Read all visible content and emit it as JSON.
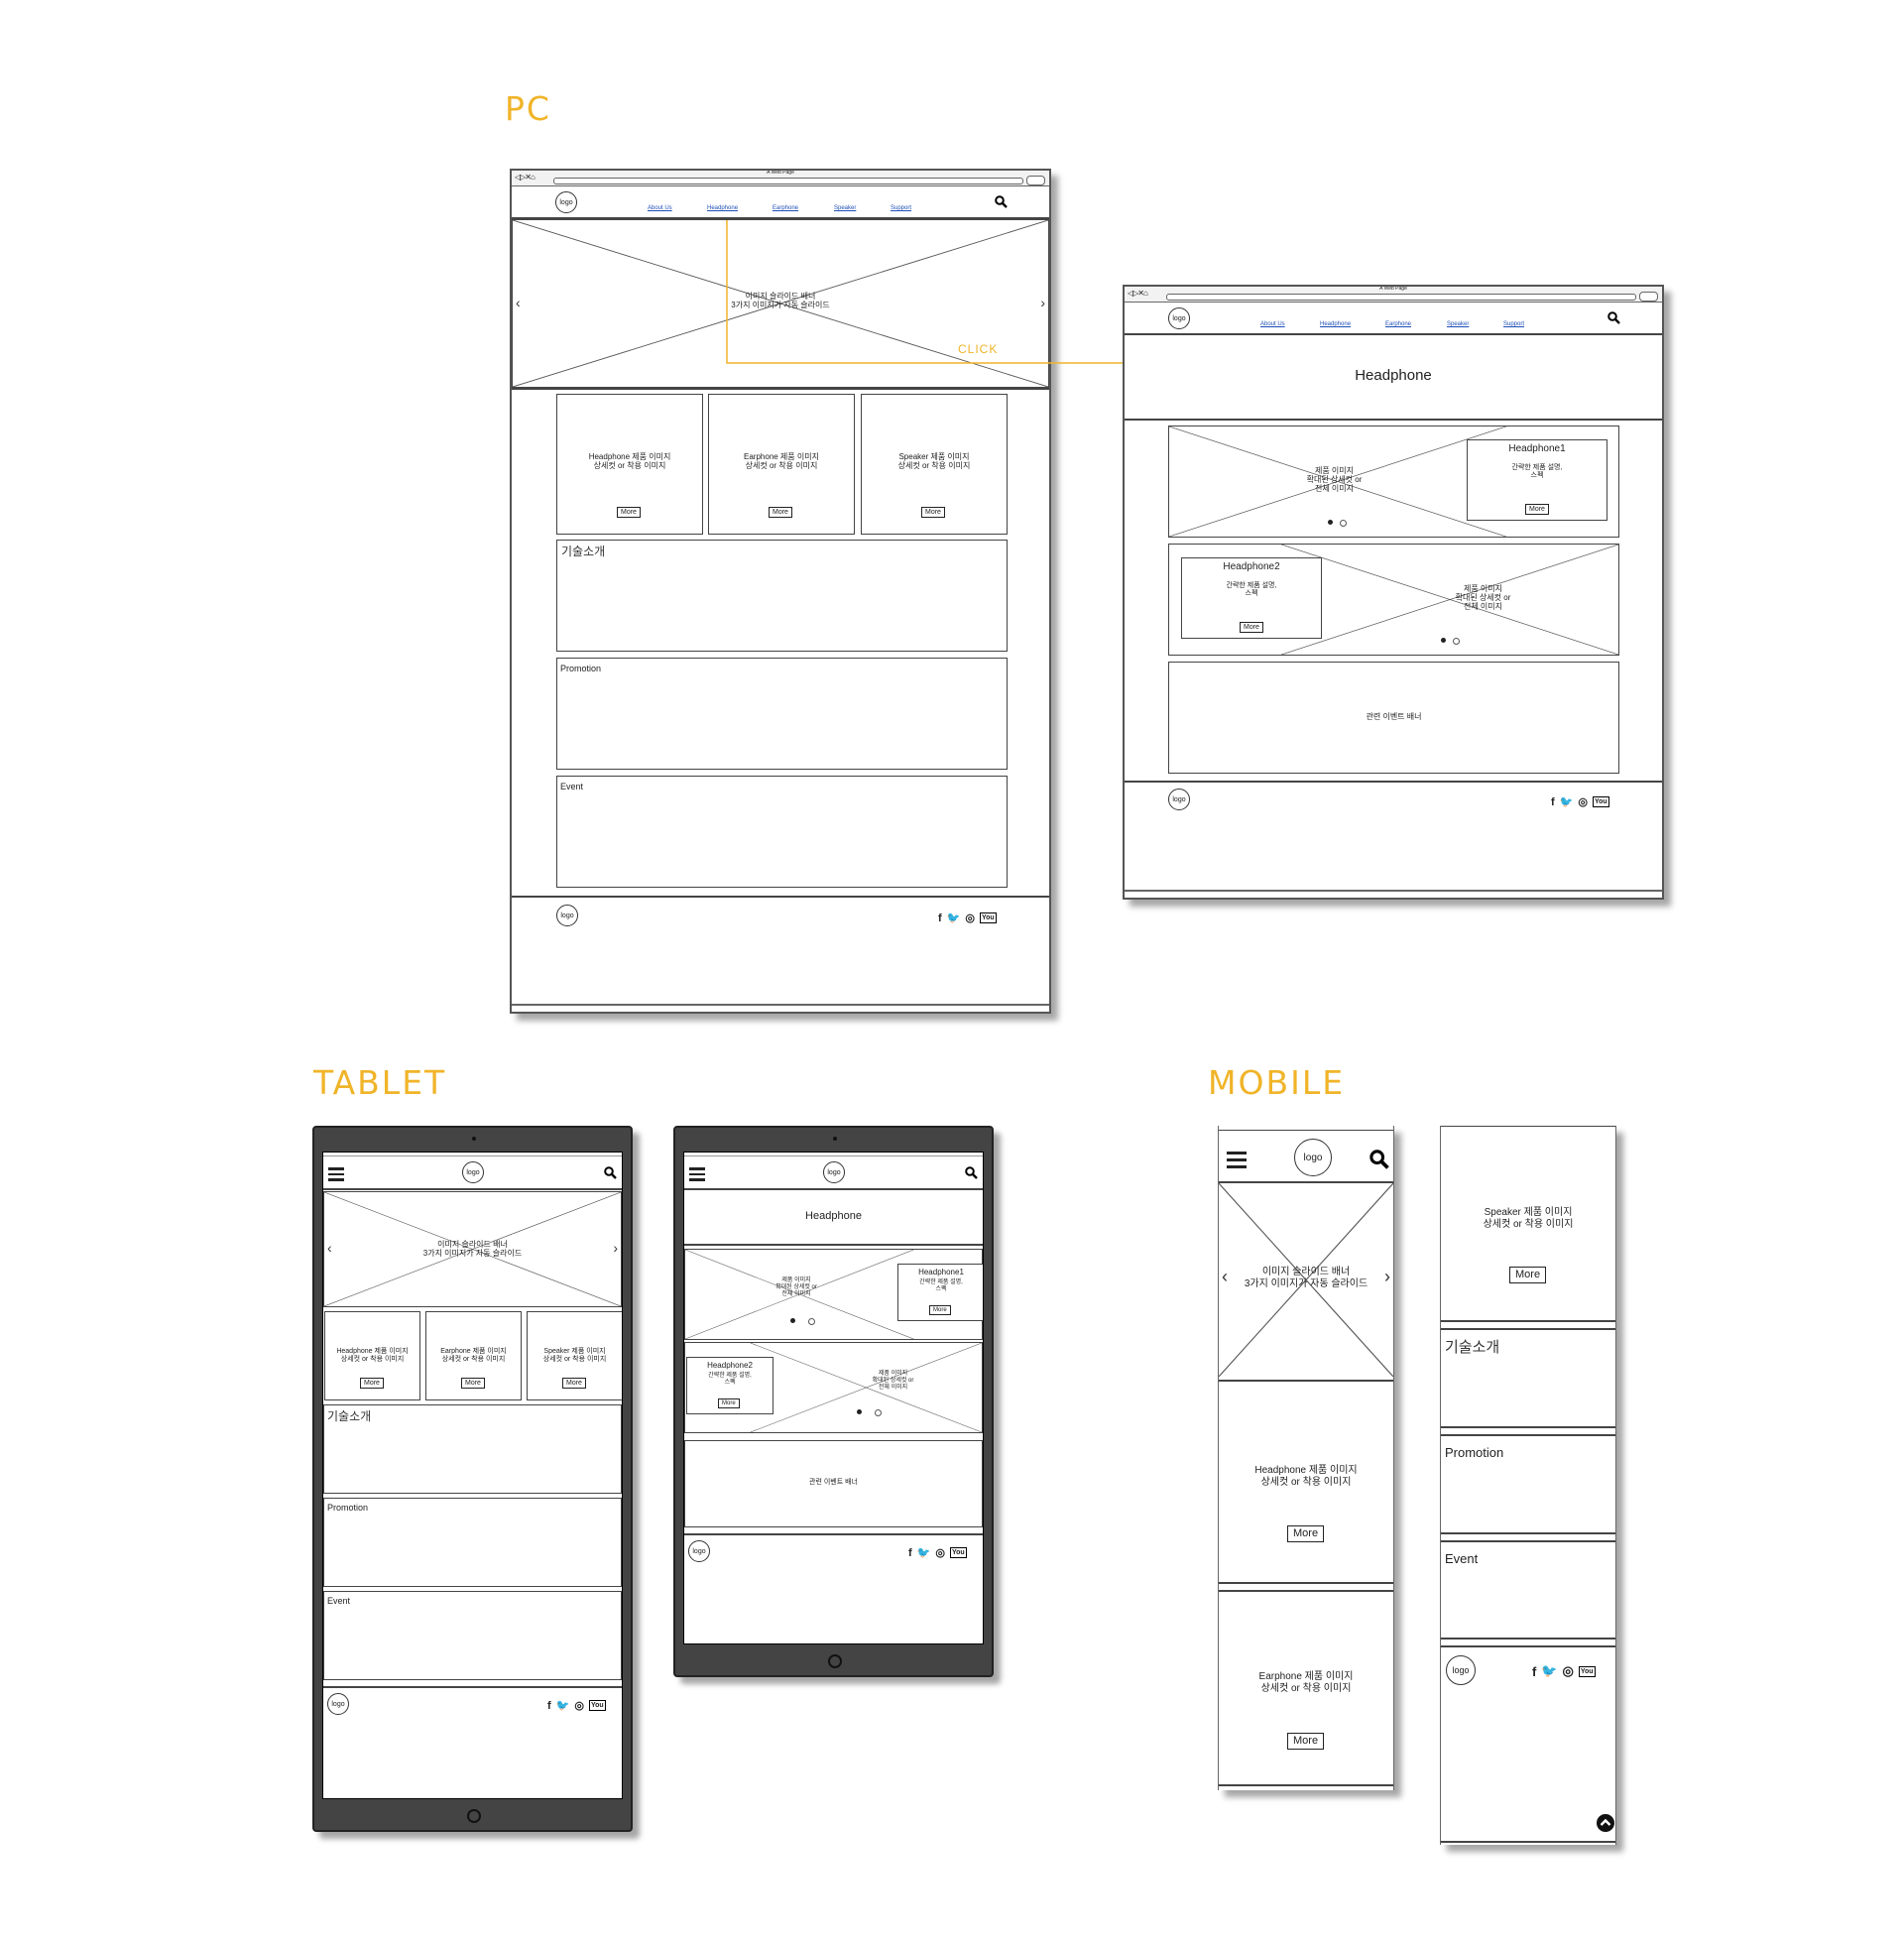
{
  "labels": {
    "pc": "PC",
    "tablet": "TABLET",
    "mobile": "MOBILE",
    "click": "CLICK"
  },
  "browser": {
    "title": "A Web Page"
  },
  "nav": {
    "logo": "logo",
    "links": [
      "About Us",
      "Headphone",
      "Earphone",
      "Speaker",
      "Support"
    ]
  },
  "home": {
    "slider_text": "이미지 슬라이드 배너\n3가지 이미지가 자동 슬라이드",
    "prev": "‹",
    "next": "›",
    "products": [
      {
        "text": "Headphone 제품 이미지\n상세컷 or 착용 이미지",
        "button": "More"
      },
      {
        "text": "Earphone 제품 이미지\n상세컷 or 착용 이미지",
        "button": "More"
      },
      {
        "text": "Speaker 제품 이미지\n상세컷 or 착용 이미지",
        "button": "More"
      }
    ],
    "tech": "기술소개",
    "promotion": "Promotion",
    "event": "Event"
  },
  "sub": {
    "title": "Headphone",
    "items": [
      {
        "name": "Headphone1",
        "desc": "간략한 제품 설명,\n스펙",
        "button": "More",
        "image": "제품 이미지\n확대된 상세컷 or\n전체 이미지"
      },
      {
        "name": "Headphone2",
        "desc": "간략한 제품 설명,\n스펙",
        "button": "More",
        "image": "제품 이미지\n확대된 상세컷 or\n전체 이미지"
      }
    ],
    "event_banner": "관련 이벤트 배너"
  },
  "footer": {
    "logo": "logo",
    "social": [
      "f",
      "🐦",
      "◎",
      "You"
    ]
  },
  "icons": {
    "search": "search-icon",
    "menu": "hamburger-menu-icon",
    "top": "scroll-top-icon"
  },
  "colors": {
    "accent": "#f0b429",
    "link": "#1f4fb8",
    "device": "#444444"
  }
}
